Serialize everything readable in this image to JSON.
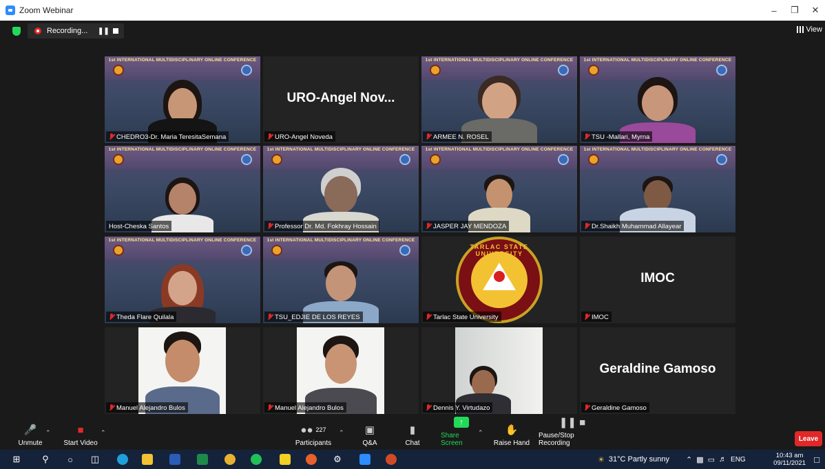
{
  "window": {
    "title": "Zoom Webinar"
  },
  "topbar": {
    "recording_label": "Recording...",
    "view_label": "View"
  },
  "tiles": {
    "conference_banner": "1st INTERNATIONAL MULTIDISCIPLINARY ONLINE CONFERENCE",
    "t1": {
      "name": "CHEDRO3-Dr. Maria TeresitaSemana"
    },
    "t2": {
      "name": "URO-Angel Noveda",
      "display": "URO-Angel  Nov..."
    },
    "t3": {
      "name": "ARMEE N. ROSEL"
    },
    "t4": {
      "name": "TSU -Mallari, Myrna"
    },
    "t5": {
      "name": "Host-Cheska Santos"
    },
    "t6": {
      "name": "Professor Dr. Md. Fokhray Hossain"
    },
    "t7": {
      "name": "JASPER JAY MENDOZA"
    },
    "t8": {
      "name": "Dr.Shaikh Muhammad Allayear"
    },
    "t9": {
      "name": "Theda Flare Quilala"
    },
    "t10": {
      "name": "TSU_EDJIE DE LOS REYES"
    },
    "t11": {
      "name": "Tarlac State University",
      "seal_text": "TARLAC STATE UNIVERSITY"
    },
    "t12": {
      "name": "IMOC",
      "display": "IMOC"
    },
    "t13": {
      "name": "Manuel Alejandro Bulos"
    },
    "t14": {
      "name": "Manuel Alejandro Bulos"
    },
    "t15": {
      "name": "Dennis Y. Virtudazo"
    },
    "t16": {
      "name": "Geraldine Gamoso",
      "display": "Geraldine Gamoso"
    }
  },
  "controls": {
    "unmute": "Unmute",
    "start_video": "Start Video",
    "participants": "Participants",
    "participant_count": "227",
    "qa": "Q&A",
    "chat": "Chat",
    "share_screen": "Share Screen",
    "raise_hand": "Raise Hand",
    "pause_stop": "Pause/Stop Recording",
    "leave": "Leave"
  },
  "taskbar": {
    "weather": "31°C  Partly sunny",
    "lang": "ENG",
    "time": "10:43 am",
    "date": "09/11/2021"
  },
  "colors": {
    "accent": "#2d8cff",
    "share": "#23d959",
    "leave": "#e02828",
    "active_speaker": "#e8e860"
  }
}
